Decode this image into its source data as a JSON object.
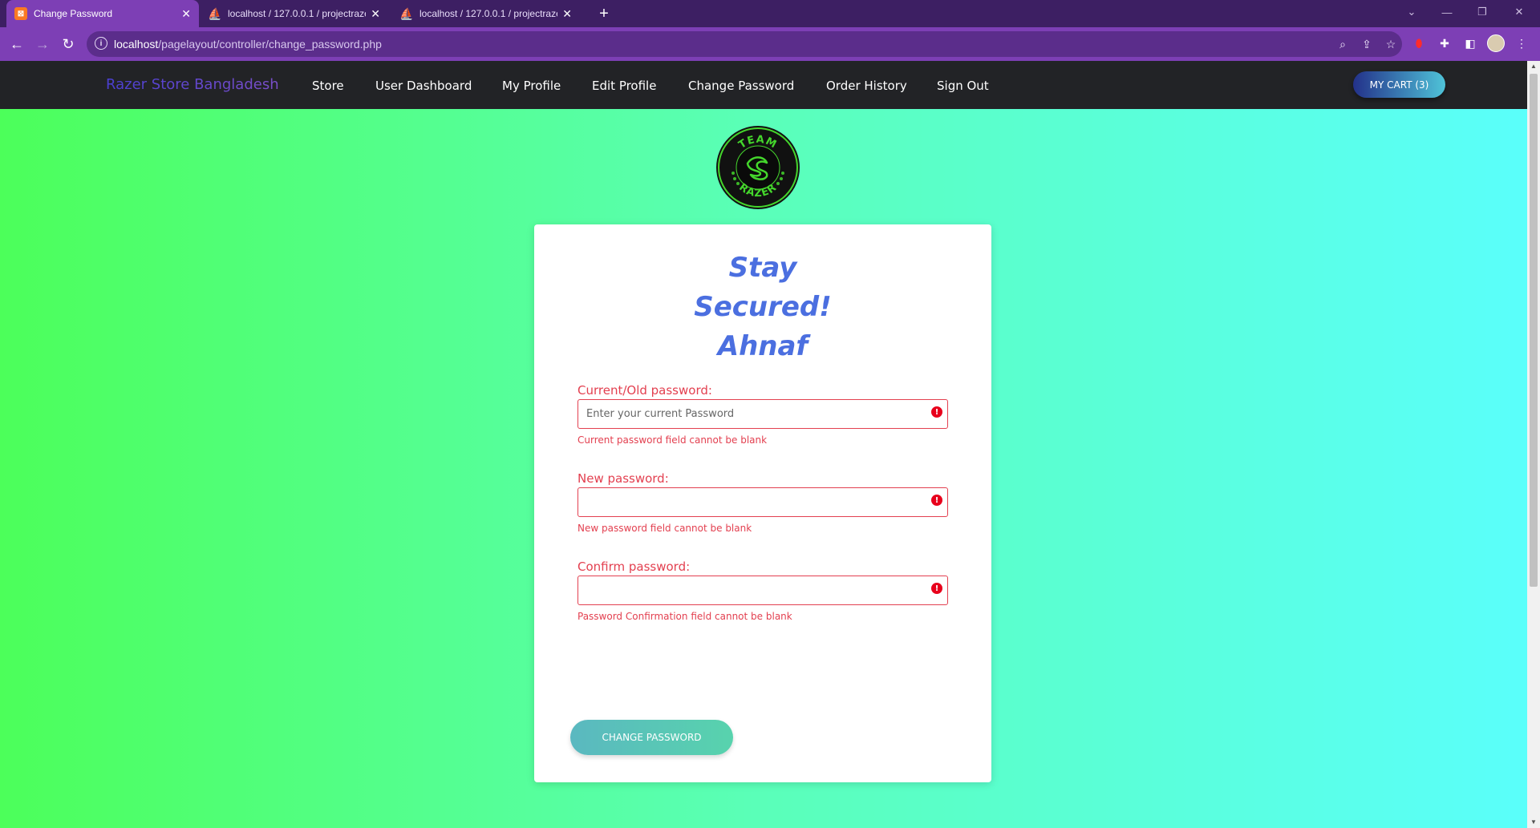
{
  "browser": {
    "tabs": [
      {
        "title": "Change Password",
        "active": true
      },
      {
        "title": "localhost / 127.0.0.1 / projectrazer",
        "active": false
      },
      {
        "title": "localhost / 127.0.0.1 / projectrazer",
        "active": false
      }
    ],
    "url_host": "localhost",
    "url_path": "/pagelayout/controller/change_password.php"
  },
  "site": {
    "brand": "Razer Store Bangladesh",
    "nav": [
      "Store",
      "User Dashboard",
      "My Profile",
      "Edit Profile",
      "Change Password",
      "Order History",
      "Sign Out"
    ],
    "cart_label": "MY CART (3)",
    "logo_top_text": "TEAM",
    "logo_bottom_text": "RAZER"
  },
  "form": {
    "title_lines": [
      "Stay",
      "Secured!",
      "Ahnaf"
    ],
    "fields": [
      {
        "label": "Current/Old password:",
        "placeholder": "Enter your current Password",
        "error": "Current password field cannot be blank"
      },
      {
        "label": "New password:",
        "placeholder": "",
        "error": "New password field cannot be blank"
      },
      {
        "label": "Confirm password:",
        "placeholder": "",
        "error": "Password Confirmation field cannot be blank"
      }
    ],
    "submit_label": "CHANGE PASSWORD"
  },
  "colors": {
    "accent": "#7d3fb5",
    "error": "#e34050",
    "title": "#4b6fe0"
  }
}
